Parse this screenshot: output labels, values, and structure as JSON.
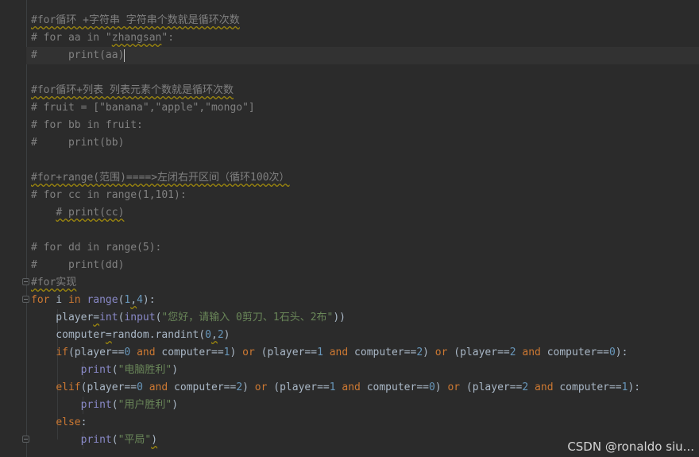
{
  "lines": [
    {
      "parts": [
        {
          "t": "#for循环 +字符串 字符串个数就是循环次数",
          "c": "cm wavy"
        }
      ]
    },
    {
      "parts": [
        {
          "t": "# for aa in \"",
          "c": "cm"
        },
        {
          "t": "zhangsan",
          "c": "cm wavy"
        },
        {
          "t": "\":",
          "c": "cm"
        }
      ]
    },
    {
      "parts": [
        {
          "t": "#     print(aa)",
          "c": "cm"
        }
      ],
      "current": true,
      "caret": true
    },
    {
      "parts": []
    },
    {
      "parts": [
        {
          "t": "#for循环+列表 列表元素个数就是循环次数",
          "c": "cm wavy"
        }
      ]
    },
    {
      "parts": [
        {
          "t": "# fruit = [\"banana\",\"apple\",\"mongo\"]",
          "c": "cm"
        }
      ]
    },
    {
      "parts": [
        {
          "t": "# for bb in fruit:",
          "c": "cm"
        }
      ]
    },
    {
      "parts": [
        {
          "t": "#     print(bb)",
          "c": "cm"
        }
      ]
    },
    {
      "parts": []
    },
    {
      "parts": [
        {
          "t": "#for+range(范围)====>左闭右开区间（循环100次）",
          "c": "cm wavy"
        }
      ]
    },
    {
      "parts": [
        {
          "t": "# for cc in range(1,101):",
          "c": "cm"
        }
      ]
    },
    {
      "parts": [
        {
          "t": "    ",
          "c": ""
        },
        {
          "t": "# print(cc)",
          "c": "cm wavy"
        }
      ]
    },
    {
      "parts": []
    },
    {
      "parts": [
        {
          "t": "# for dd in range(5):",
          "c": "cm"
        }
      ]
    },
    {
      "parts": [
        {
          "t": "#     print(dd)",
          "c": "cm"
        }
      ]
    },
    {
      "parts": [
        {
          "t": "#for实现",
          "c": "cm wavy"
        }
      ]
    },
    {
      "parts": [
        {
          "t": "for",
          "c": "kw"
        },
        {
          "t": " i ",
          "c": ""
        },
        {
          "t": "in",
          "c": "kw"
        },
        {
          "t": " ",
          "c": ""
        },
        {
          "t": "range",
          "c": "bi"
        },
        {
          "t": "(",
          "c": ""
        },
        {
          "t": "1",
          "c": "num"
        },
        {
          "t": ",",
          "c": "wavy"
        },
        {
          "t": "4",
          "c": "num"
        },
        {
          "t": "):",
          "c": ""
        }
      ]
    },
    {
      "parts": [
        {
          "t": "    player",
          "c": ""
        },
        {
          "t": "=",
          "c": "wavy"
        },
        {
          "t": "int",
          "c": "bi"
        },
        {
          "t": "(",
          "c": ""
        },
        {
          "t": "input",
          "c": "bi"
        },
        {
          "t": "(",
          "c": ""
        },
        {
          "t": "\"您好，请输入 0剪刀、1石头、2布\"",
          "c": "str"
        },
        {
          "t": "))",
          "c": ""
        }
      ]
    },
    {
      "parts": [
        {
          "t": "    computer",
          "c": ""
        },
        {
          "t": "=",
          "c": "wavy"
        },
        {
          "t": "random.randint(",
          "c": ""
        },
        {
          "t": "0",
          "c": "num"
        },
        {
          "t": ",",
          "c": "wavy"
        },
        {
          "t": "2",
          "c": "num"
        },
        {
          "t": ")",
          "c": ""
        }
      ]
    },
    {
      "parts": [
        {
          "t": "    ",
          "c": ""
        },
        {
          "t": "if",
          "c": "kw"
        },
        {
          "t": "(player==",
          "c": ""
        },
        {
          "t": "0",
          "c": "num"
        },
        {
          "t": " ",
          "c": ""
        },
        {
          "t": "and",
          "c": "kw"
        },
        {
          "t": " computer==",
          "c": ""
        },
        {
          "t": "1",
          "c": "num"
        },
        {
          "t": ") ",
          "c": ""
        },
        {
          "t": "or",
          "c": "kw"
        },
        {
          "t": " (player==",
          "c": ""
        },
        {
          "t": "1",
          "c": "num"
        },
        {
          "t": " ",
          "c": ""
        },
        {
          "t": "and",
          "c": "kw"
        },
        {
          "t": " computer==",
          "c": ""
        },
        {
          "t": "2",
          "c": "num"
        },
        {
          "t": ") ",
          "c": ""
        },
        {
          "t": "or",
          "c": "kw"
        },
        {
          "t": " (player==",
          "c": ""
        },
        {
          "t": "2",
          "c": "num"
        },
        {
          "t": " ",
          "c": ""
        },
        {
          "t": "and",
          "c": "kw"
        },
        {
          "t": " computer==",
          "c": ""
        },
        {
          "t": "0",
          "c": "num"
        },
        {
          "t": "):",
          "c": ""
        }
      ]
    },
    {
      "parts": [
        {
          "t": "        ",
          "c": ""
        },
        {
          "t": "print",
          "c": "bi"
        },
        {
          "t": "(",
          "c": ""
        },
        {
          "t": "\"电脑胜利\"",
          "c": "str"
        },
        {
          "t": ")",
          "c": ""
        }
      ]
    },
    {
      "parts": [
        {
          "t": "    ",
          "c": ""
        },
        {
          "t": "elif",
          "c": "kw"
        },
        {
          "t": "(player==",
          "c": ""
        },
        {
          "t": "0",
          "c": "num"
        },
        {
          "t": " ",
          "c": ""
        },
        {
          "t": "and",
          "c": "kw"
        },
        {
          "t": " computer==",
          "c": ""
        },
        {
          "t": "2",
          "c": "num"
        },
        {
          "t": ") ",
          "c": ""
        },
        {
          "t": "or",
          "c": "kw"
        },
        {
          "t": " (player==",
          "c": ""
        },
        {
          "t": "1",
          "c": "num"
        },
        {
          "t": " ",
          "c": ""
        },
        {
          "t": "and",
          "c": "kw"
        },
        {
          "t": " computer==",
          "c": ""
        },
        {
          "t": "0",
          "c": "num"
        },
        {
          "t": ") ",
          "c": ""
        },
        {
          "t": "or",
          "c": "kw"
        },
        {
          "t": " (player==",
          "c": ""
        },
        {
          "t": "2",
          "c": "num"
        },
        {
          "t": " ",
          "c": ""
        },
        {
          "t": "and",
          "c": "kw"
        },
        {
          "t": " computer==",
          "c": ""
        },
        {
          "t": "1",
          "c": "num"
        },
        {
          "t": "):",
          "c": ""
        }
      ]
    },
    {
      "parts": [
        {
          "t": "        ",
          "c": ""
        },
        {
          "t": "print",
          "c": "bi"
        },
        {
          "t": "(",
          "c": ""
        },
        {
          "t": "\"用户胜利\"",
          "c": "str"
        },
        {
          "t": ")",
          "c": ""
        }
      ]
    },
    {
      "parts": [
        {
          "t": "    ",
          "c": ""
        },
        {
          "t": "else",
          "c": "kw"
        },
        {
          "t": ":",
          "c": ""
        }
      ]
    },
    {
      "parts": [
        {
          "t": "        ",
          "c": ""
        },
        {
          "t": "print",
          "c": "bi"
        },
        {
          "t": "(",
          "c": ""
        },
        {
          "t": "\"平局\"",
          "c": "str"
        },
        {
          "t": ")",
          "c": "wavy"
        }
      ]
    }
  ],
  "watermark": "CSDN @ronaldo siu...",
  "colors": {
    "background": "#2b2b2b",
    "comment": "#808080",
    "keyword": "#cc7832",
    "number": "#6897bb",
    "string": "#6a8759",
    "builtin": "#8888c6",
    "text": "#a9b7c6"
  }
}
